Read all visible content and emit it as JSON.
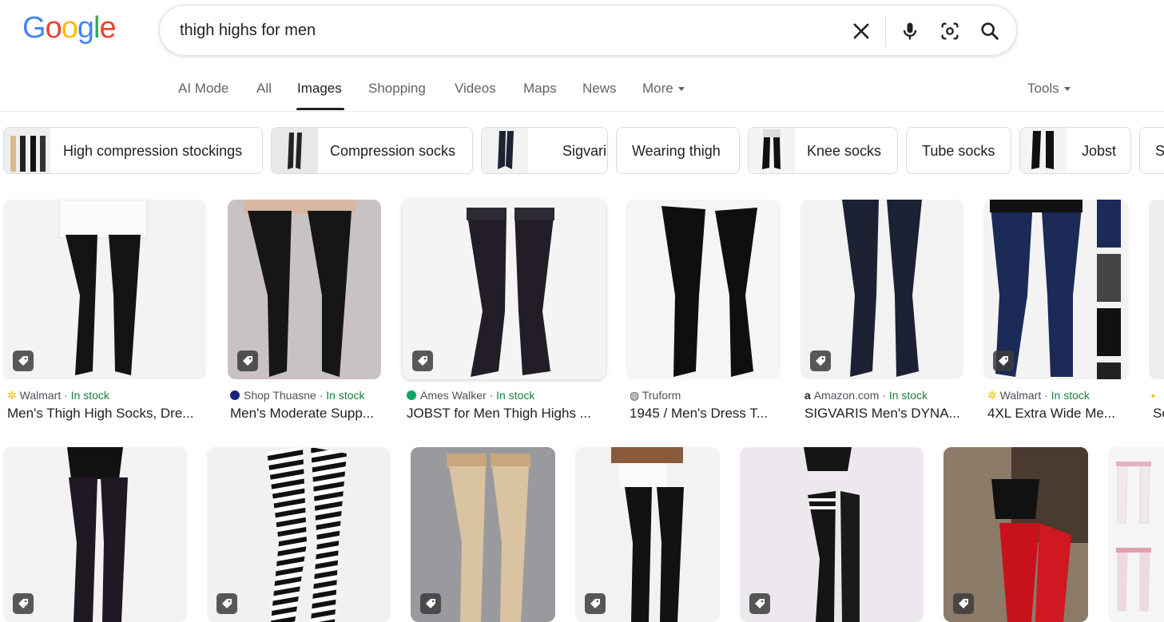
{
  "logo": {
    "letters": [
      "G",
      "o",
      "o",
      "g",
      "l",
      "e"
    ]
  },
  "search": {
    "query": "thigh highs for men"
  },
  "icons": {
    "clear": "close-icon",
    "voice": "mic-icon",
    "lens": "camera-lens-icon",
    "search": "search-icon"
  },
  "tabs": [
    {
      "label": "AI Mode"
    },
    {
      "label": "All"
    },
    {
      "label": "Images",
      "active": true
    },
    {
      "label": "Shopping"
    },
    {
      "label": "Videos"
    },
    {
      "label": "Maps"
    },
    {
      "label": "News"
    },
    {
      "label": "More"
    }
  ],
  "tools": {
    "label": "Tools"
  },
  "chips": [
    {
      "label": "High compression stockings"
    },
    {
      "label": "Compression socks"
    },
    {
      "label": "Sigvaris"
    },
    {
      "label": "Wearing thigh"
    },
    {
      "label": "Knee socks"
    },
    {
      "label": "Tube socks"
    },
    {
      "label": "Jobst"
    },
    {
      "label": "S"
    }
  ],
  "results_row1": [
    {
      "source": "Walmart",
      "stock": "In stock",
      "title": "Men's Thigh High Socks, Dre...",
      "source_color": "#fbbc05"
    },
    {
      "source": "Shop Thuasne",
      "stock": "In stock",
      "title": "Men's Moderate Supp...",
      "source_color": "#1a237e"
    },
    {
      "source": "Ames Walker",
      "stock": "In stock",
      "title": "JOBST for Men Thigh Highs ...",
      "source_color": "#12a36a"
    },
    {
      "source": "Truform",
      "stock": "",
      "title": "1945 / Men's Dress T...",
      "source_color": "#5f6368"
    },
    {
      "source": "Amazon.com",
      "stock": "In stock",
      "title": "SIGVARIS Men's DYNA...",
      "source_color": "#202124"
    },
    {
      "source": "Walmart",
      "stock": "In stock",
      "title": "4XL Extra Wide Me...",
      "source_color": "#fbbc05"
    },
    {
      "source": "",
      "stock": "",
      "title": "Sc",
      "source_color": "#fbbc05"
    }
  ],
  "sep": " · ",
  "colors": {
    "link_green": "#188038",
    "active_tab": "#202124"
  }
}
